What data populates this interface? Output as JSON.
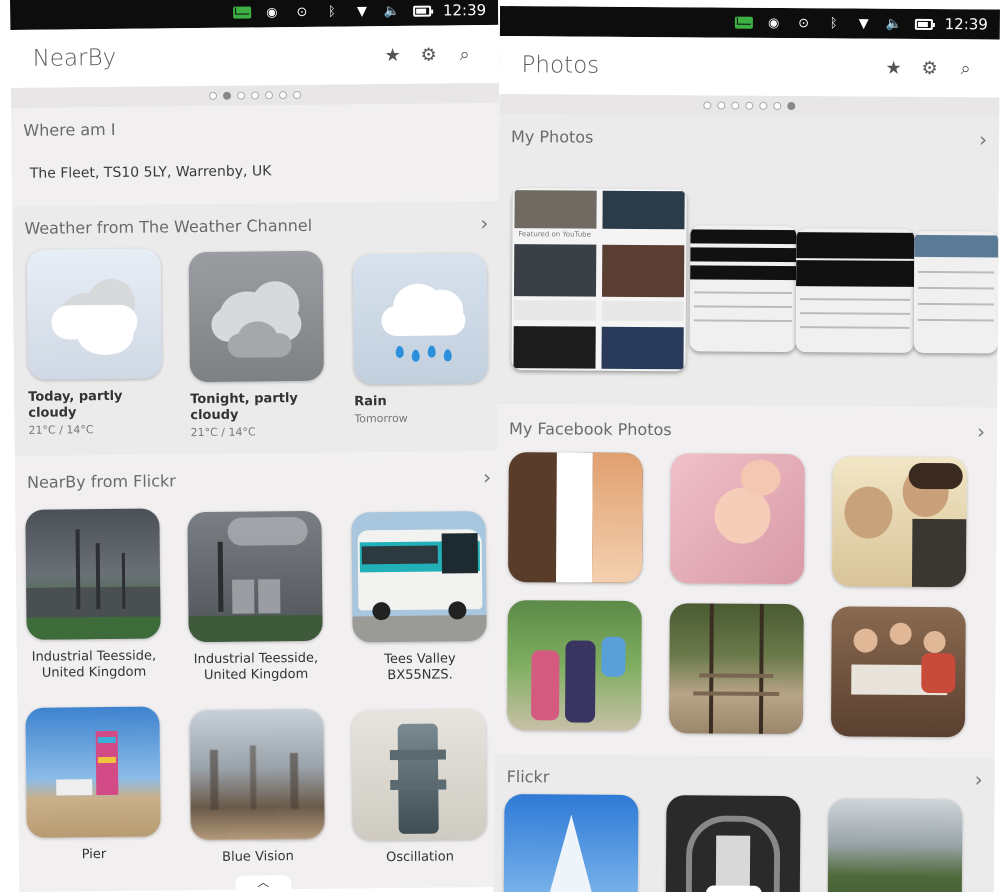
{
  "status_bar": {
    "time": "12:39"
  },
  "left": {
    "title": "NearBy",
    "page_dots": 7,
    "active_dot": 1,
    "where": {
      "title": "Where am I",
      "address": "The Fleet, TS10 5LY, Warrenby, UK"
    },
    "weather": {
      "title": "Weather from The Weather Channel",
      "items": [
        {
          "label": "Today, partly cloudy",
          "sub": "21°C / 14°C",
          "icon": "partly-cloudy-icon"
        },
        {
          "label": "Tonight, partly cloudy",
          "sub": "21°C / 14°C",
          "icon": "cloudy-night-icon"
        },
        {
          "label": "Rain",
          "sub": "Tomorrow",
          "icon": "rain-icon"
        }
      ]
    },
    "flickr": {
      "title": "NearBy from Flickr",
      "items": [
        {
          "label": "Industrial Teesside, United Kingdom"
        },
        {
          "label": "Industrial Teesside, United Kingdom"
        },
        {
          "label": "Tees Valley BX55NZS."
        },
        {
          "label": "Pier"
        },
        {
          "label": "Blue Vision"
        },
        {
          "label": "Oscillation"
        }
      ]
    }
  },
  "right": {
    "title": "Photos",
    "page_dots": 7,
    "active_dot": 6,
    "sections": {
      "my_photos": "My Photos",
      "facebook": "My Facebook Photos",
      "flickr": "Flickr"
    },
    "youtube_snippet": "Featured on YouTube"
  },
  "colors": {
    "status_bg": "#0d0d0d",
    "mail_green": "#3cb043",
    "rain_blue": "#2a90dc"
  }
}
